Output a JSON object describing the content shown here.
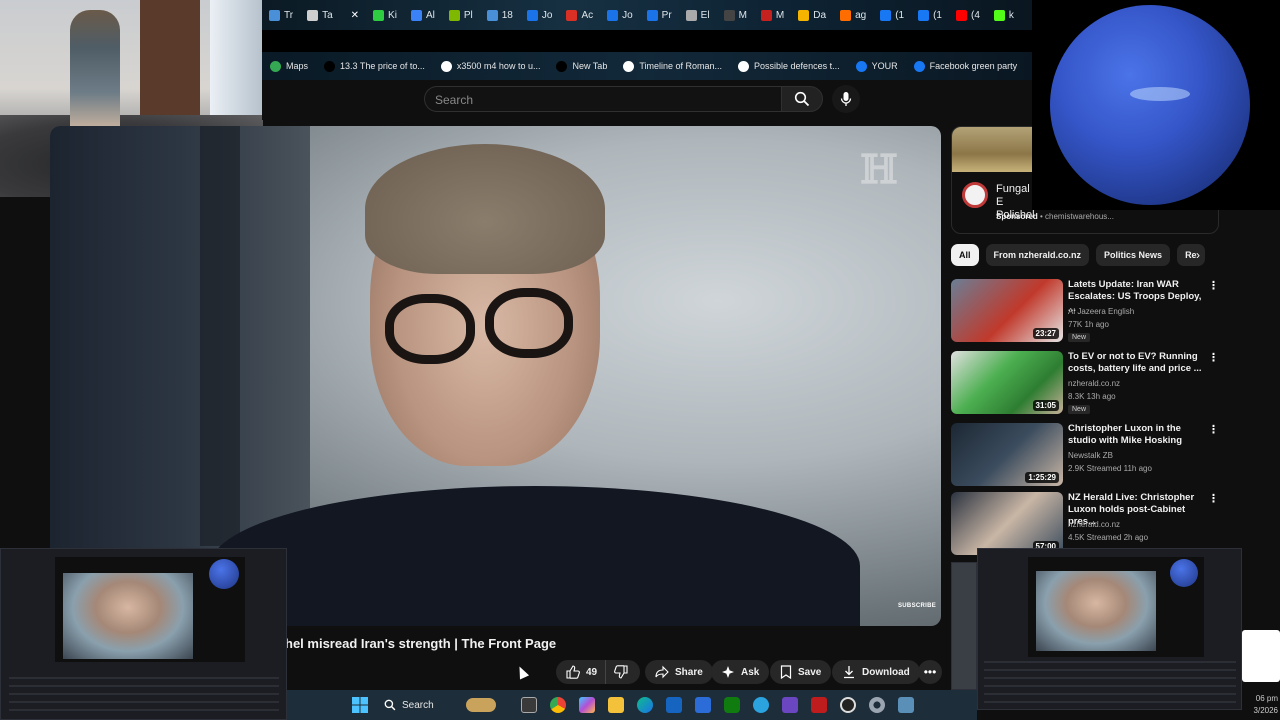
{
  "browser": {
    "tabs": [
      {
        "label": "Tr",
        "color": "#4a90d9"
      },
      {
        "label": "Ta",
        "color": "#cfcfcf"
      },
      {
        "label": "✕",
        "color": "#777777",
        "active": true
      },
      {
        "label": "Ki",
        "color": "#2ecc40"
      },
      {
        "label": "Al",
        "color": "#3b82f6"
      },
      {
        "label": "Pl",
        "color": "#7fb800"
      },
      {
        "label": "18",
        "color": "#4a90d9"
      },
      {
        "label": "Jo",
        "color": "#1a73e8"
      },
      {
        "label": "Ac",
        "color": "#d93025"
      },
      {
        "label": "Jo",
        "color": "#1a73e8"
      },
      {
        "label": "Pr",
        "color": "#1a73e8"
      },
      {
        "label": "El",
        "color": "#aaaaaa"
      },
      {
        "label": "M",
        "color": "#444444"
      },
      {
        "label": "M",
        "color": "#c5221f"
      },
      {
        "label": "Da",
        "color": "#f4b400"
      },
      {
        "label": "ag",
        "color": "#ff6d00"
      },
      {
        "label": "(1",
        "color": "#1877f2"
      },
      {
        "label": "(1",
        "color": "#1877f2"
      },
      {
        "label": "(4",
        "color": "#ff0000"
      },
      {
        "label": "k",
        "color": "#53fc18"
      }
    ],
    "bookmarks": [
      {
        "label": "Maps",
        "color": "#34a853"
      },
      {
        "label": "13.3 The price of to...",
        "color": "#000000"
      },
      {
        "label": "x3500 m4 how to u...",
        "color": "#ffffff"
      },
      {
        "label": "New Tab",
        "color": "#000000"
      },
      {
        "label": "Timeline of Roman...",
        "color": "#ffffff"
      },
      {
        "label": "Possible defences t...",
        "color": "#ffffff"
      },
      {
        "label": "YOUR",
        "color": "#1877f2"
      },
      {
        "label": "Facebook green party",
        "color": "#1877f2"
      }
    ]
  },
  "youtube": {
    "search_placeholder": "Search",
    "video_title": "hel misread Iran's strength | The Front Page",
    "watermark": "ℍ",
    "subscribe_overlay": "SUBSCRIBE",
    "actions": {
      "like_count": "49",
      "share": "Share",
      "ask": "Ask",
      "save": "Save",
      "download": "Download"
    },
    "ad": {
      "title": "Fungal E Polishel",
      "sponsored_label": "Sponsored",
      "sponsor": "chemistwarehous..."
    },
    "chips": [
      "All",
      "From nzherald.co.nz",
      "Politics News",
      "Re"
    ],
    "recommendations": [
      {
        "title": "Latets Update: Iran WAR Escalates: US Troops Deploy, ...",
        "channel": "Al Jazeera English",
        "meta": "77K  1h ago",
        "badge": "New",
        "duration": "23:27",
        "thumb": "linear-gradient(135deg,#6a7f96,#c0392b 55%,#e6e6e6)"
      },
      {
        "title": "To EV or not to EV? Running costs, battery life and price ...",
        "channel": "nzherald.co.nz",
        "meta": "8.3K  13h ago",
        "badge": "New",
        "duration": "31:05",
        "thumb": "linear-gradient(135deg,#e0e0e0,#4caf50 40%,#2e7d32 70%,#c7b199)"
      },
      {
        "title": "Christopher Luxon in the studio with Mike Hosking",
        "channel": "Newstalk ZB",
        "meta": "2.9K  Streamed 11h ago",
        "badge": "",
        "duration": "1:25:29",
        "thumb": "linear-gradient(135deg,#1c2733,#3b4c5e 50%,#c9b6a5)"
      },
      {
        "title": "NZ Herald Live: Christopher Luxon holds post-Cabinet pres...",
        "channel": "nzherald.co.nz",
        "meta": "4.5K  Streamed 2h ago",
        "badge": "",
        "duration": "57:00",
        "thumb": "linear-gradient(135deg,#2b3340,#c9b6a5 50%,#3b4c5e)"
      }
    ]
  },
  "taskbar": {
    "search_label": "Search",
    "clock_time": "06 pm",
    "clock_date": "3/2026"
  }
}
